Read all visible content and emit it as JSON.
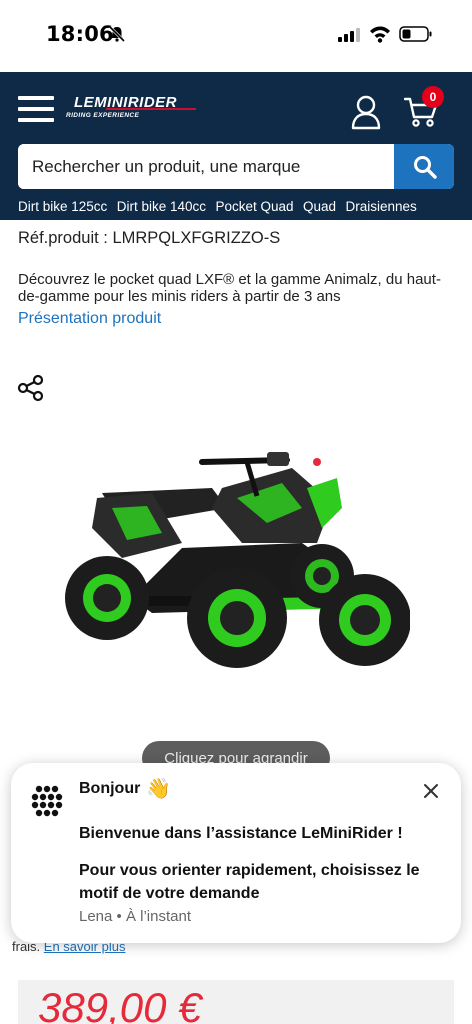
{
  "status_bar": {
    "time": "18:06"
  },
  "header": {
    "logo_text": "LEMINIRIDER",
    "logo_tagline": "RIDING EXPERIENCE",
    "cart_count": "0",
    "search": {
      "placeholder": "Rechercher un produit, une marque"
    },
    "categories": [
      "Dirt bike 125cc",
      "Dirt bike 140cc",
      "Pocket Quad",
      "Quad",
      "Draisiennes"
    ]
  },
  "product": {
    "reference": "Réf.produit : LMRPQLXFGRIZZO-S",
    "description": "Découvrez le pocket quad LXF® et la gamme Animalz, du haut-de-gamme pour les minis riders à partir de 3 ans",
    "presentation_link": "Présentation produit",
    "zoom_hint": "Cliquez pour agrandir",
    "fees_text": "frais.",
    "fees_link": "En savoir plus",
    "price": "389,00 €"
  },
  "chat": {
    "greeting": "Bonjour",
    "wave": "👋",
    "message1": "Bienvenue dans l’assistance LeMiniRider !",
    "message2": "Pour vous orienter rapidement, choisissez le motif de votre demande",
    "meta": "Lena • À l’instant"
  },
  "colors": {
    "header_bg": "#0e2a47",
    "search_button": "#1e73be",
    "link": "#1e73be",
    "price": "#e52a3a",
    "badge": "#e3001b",
    "quad_green": "#2fcc1f"
  }
}
